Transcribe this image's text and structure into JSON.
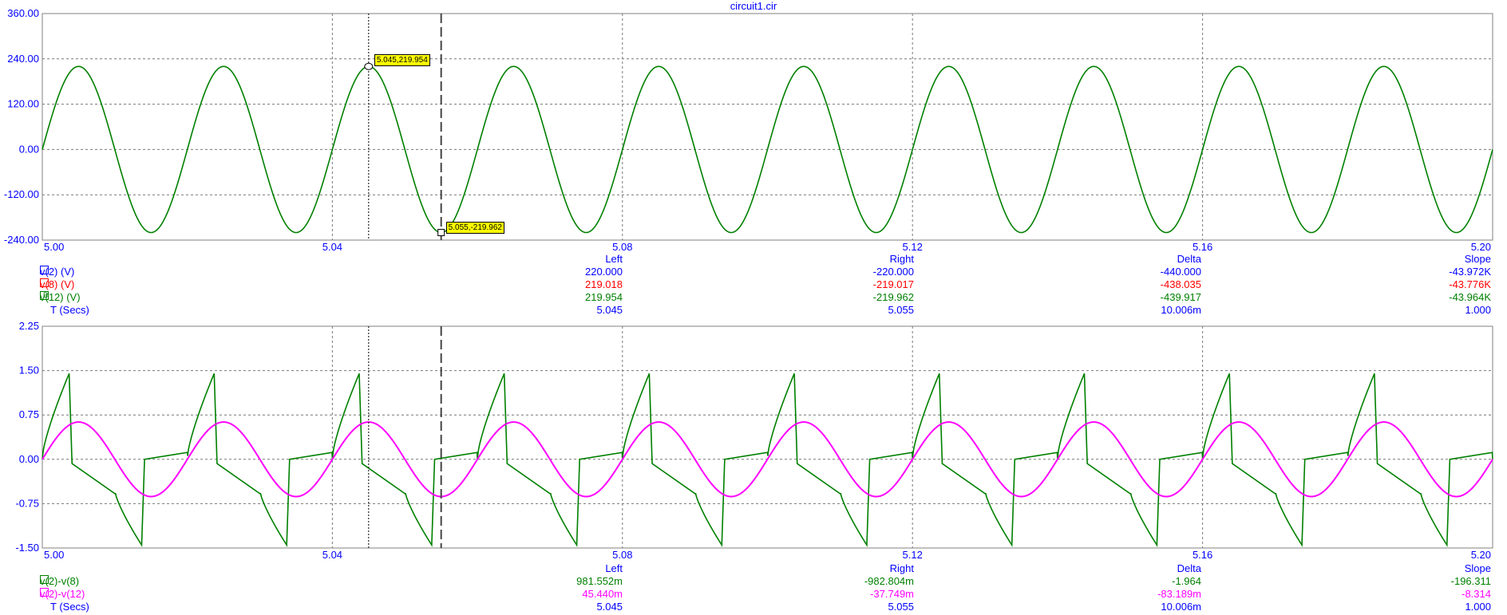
{
  "window_title": "circuit1.cir",
  "cursor_tips": {
    "left": "5.045,219.954",
    "right": "5.055,-219.962"
  },
  "chart_data": [
    {
      "type": "line",
      "title": "circuit1.cir",
      "xlim": [
        5.0,
        5.2
      ],
      "ylim": [
        -240,
        360
      ],
      "grid": true,
      "x_ticks": [
        "5.00",
        "5.04",
        "5.08",
        "5.12",
        "5.16",
        "5.20"
      ],
      "y_ticks": [
        "360.00",
        "240.00",
        "120.00",
        "0.00",
        "-120.00",
        "-240.00"
      ],
      "cursors": {
        "left": 5.045,
        "right": 5.055
      },
      "series": [
        {
          "name": "v(2) (V)",
          "color": "#0000ff",
          "amplitude": 220.0,
          "frequency_hz": 50,
          "waveform": "sine",
          "visible": false
        },
        {
          "name": "v(8) (V)",
          "color": "#ff0000",
          "amplitude": 219.018,
          "frequency_hz": 50,
          "waveform": "sine",
          "visible": false
        },
        {
          "name": "v(12) (V)",
          "color": "#008000",
          "amplitude": 219.954,
          "frequency_hz": 50,
          "waveform": "sine",
          "visible": true
        }
      ],
      "table": {
        "headers": [
          "Left",
          "Right",
          "Delta",
          "Slope"
        ],
        "rows": [
          {
            "label": "v(2) (V)",
            "color": "#0000ff",
            "marker": "",
            "left": "220.000",
            "right": "-220.000",
            "delta": "-440.000",
            "slope": "-43.972K"
          },
          {
            "label": "v(8) (V)",
            "color": "#ff0000",
            "marker": "",
            "left": "219.018",
            "right": "-219.017",
            "delta": "-438.035",
            "slope": "-43.776K"
          },
          {
            "label": "v(12) (V)",
            "color": "#008000",
            "marker": "B",
            "left": "219.954",
            "right": "-219.962",
            "delta": "-439.917",
            "slope": "-43.964K"
          },
          {
            "label": "T (Secs)",
            "color": "#0000ff",
            "marker": null,
            "left": "5.045",
            "right": "5.055",
            "delta": "10.006m",
            "slope": "1.000"
          }
        ]
      }
    },
    {
      "type": "line",
      "xlim": [
        5.0,
        5.2
      ],
      "ylim": [
        -1.5,
        2.25
      ],
      "grid": true,
      "x_ticks": [
        "5.00",
        "5.04",
        "5.08",
        "5.12",
        "5.16",
        "5.20"
      ],
      "y_ticks": [
        "2.25",
        "1.50",
        "0.75",
        "0.00",
        "-0.75",
        "-1.50"
      ],
      "cursors": {
        "left": 5.045,
        "right": 5.055
      },
      "series": [
        {
          "name": "v(2)-v(8)",
          "color": "#008000",
          "peak": 1.45,
          "frequency_hz": 50,
          "waveform": "distorted"
        },
        {
          "name": "v(2)-v(12)",
          "color": "#ff00ff",
          "amplitude": 0.63,
          "frequency_hz": 50,
          "waveform": "sine"
        }
      ],
      "table": {
        "headers": [
          "Left",
          "Right",
          "Delta",
          "Slope"
        ],
        "rows": [
          {
            "label": "v(2)-v(8)",
            "color": "#008000",
            "marker": "",
            "left": "981.552m",
            "right": "-982.804m",
            "delta": "-1.964",
            "slope": "-196.311"
          },
          {
            "label": "v(2)-v(12)",
            "color": "#ff00ff",
            "marker": "",
            "left": "45.440m",
            "right": "-37.749m",
            "delta": "-83.189m",
            "slope": "-8.314"
          },
          {
            "label": "T (Secs)",
            "color": "#0000ff",
            "marker": null,
            "left": "5.045",
            "right": "5.055",
            "delta": "10.006m",
            "slope": "1.000"
          }
        ]
      }
    }
  ]
}
